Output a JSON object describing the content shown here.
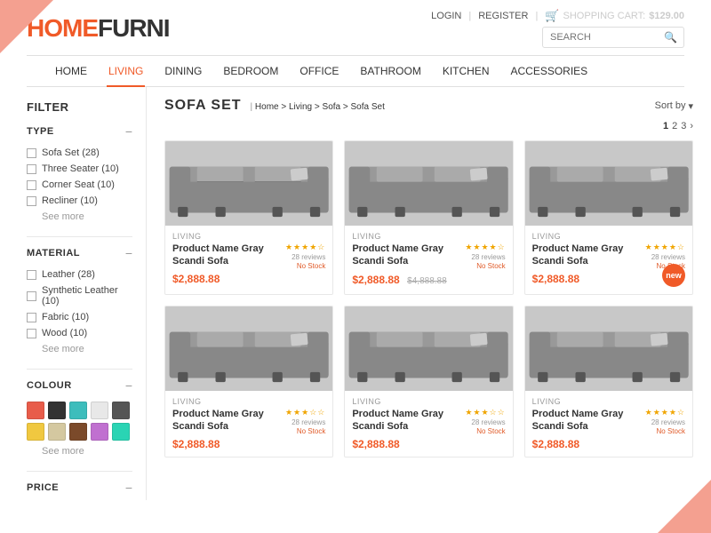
{
  "logo": {
    "home": "HOME",
    "furni": "FURNI"
  },
  "header": {
    "login": "LOGIN",
    "register": "REGISTER",
    "cart_label": "SHOPPING CART:",
    "cart_price": "$129.00",
    "search_placeholder": "SEARCH"
  },
  "nav": {
    "items": [
      {
        "label": "HOME",
        "active": false
      },
      {
        "label": "LIVING",
        "active": true
      },
      {
        "label": "DINING",
        "active": false
      },
      {
        "label": "BEDROOM",
        "active": false
      },
      {
        "label": "OFFICE",
        "active": false
      },
      {
        "label": "BATHROOM",
        "active": false
      },
      {
        "label": "KITCHEN",
        "active": false
      },
      {
        "label": "ACCESSORIES",
        "active": false
      }
    ]
  },
  "sidebar": {
    "title": "FILTER",
    "sections": [
      {
        "id": "type",
        "title": "TYPE",
        "items": [
          {
            "label": "Sofa Set (28)"
          },
          {
            "label": "Three Seater (10)"
          },
          {
            "label": "Corner Seat (10)"
          },
          {
            "label": "Recliner (10)"
          }
        ],
        "see_more": "See more"
      },
      {
        "id": "material",
        "title": "MATERIAL",
        "items": [
          {
            "label": "Leather (28)"
          },
          {
            "label": "Synthetic Leather (10)"
          },
          {
            "label": "Fabric (10)"
          },
          {
            "label": "Wood (10)"
          }
        ],
        "see_more": "See more"
      },
      {
        "id": "colour",
        "title": "COLOUR",
        "swatches": [
          "#e85c4a",
          "#333333",
          "#3dbdbc",
          "#e8e8e8",
          "#555555",
          "#f0c840",
          "#d4c8a0",
          "#7b4a2a",
          "#c070d0",
          "#2ad4b4"
        ],
        "see_more": "See more"
      },
      {
        "id": "price",
        "title": "PRICE"
      }
    ]
  },
  "product_area": {
    "title": "SOFA SET",
    "breadcrumb": "Home > Living > Sofa > Sofa Set",
    "sort_label": "Sort by",
    "pagination": [
      "1",
      "2",
      "3"
    ],
    "products": [
      {
        "category": "LIVING",
        "name": "Product Name Gray Scandi Sofa",
        "stars": "★★★★☆",
        "reviews": "28 reviews",
        "stock": "No Stock",
        "price": "$2,888.88",
        "old_price": null,
        "new_badge": false
      },
      {
        "category": "LIVING",
        "name": "Product Name Gray Scandi Sofa",
        "stars": "★★★★☆",
        "reviews": "28 reviews",
        "stock": "No Stock",
        "price": "$2,888.88",
        "old_price": "$4,888.88",
        "new_badge": false
      },
      {
        "category": "LIVING",
        "name": "Product Name Gray Scandi Sofa",
        "stars": "★★★★☆",
        "reviews": "28 reviews",
        "stock": "No Stock",
        "price": "$2,888.88",
        "old_price": null,
        "new_badge": true
      },
      {
        "category": "LIVING",
        "name": "Product Name Gray Scandi Sofa",
        "stars": "★★★☆☆",
        "reviews": "28 reviews",
        "stock": "No Stock",
        "price": "$2,888.88",
        "old_price": null,
        "new_badge": false
      },
      {
        "category": "LIVING",
        "name": "Product Name Gray Scandi Sofa",
        "stars": "★★★☆☆",
        "reviews": "28 reviews",
        "stock": "No Stock",
        "price": "$2,888.88",
        "old_price": null,
        "new_badge": false
      },
      {
        "category": "LIVING",
        "name": "Product Name Gray Scandi Sofa",
        "stars": "★★★★☆",
        "reviews": "28 reviews",
        "stock": "No Stock",
        "price": "$2,888.88",
        "old_price": null,
        "new_badge": false
      }
    ]
  }
}
